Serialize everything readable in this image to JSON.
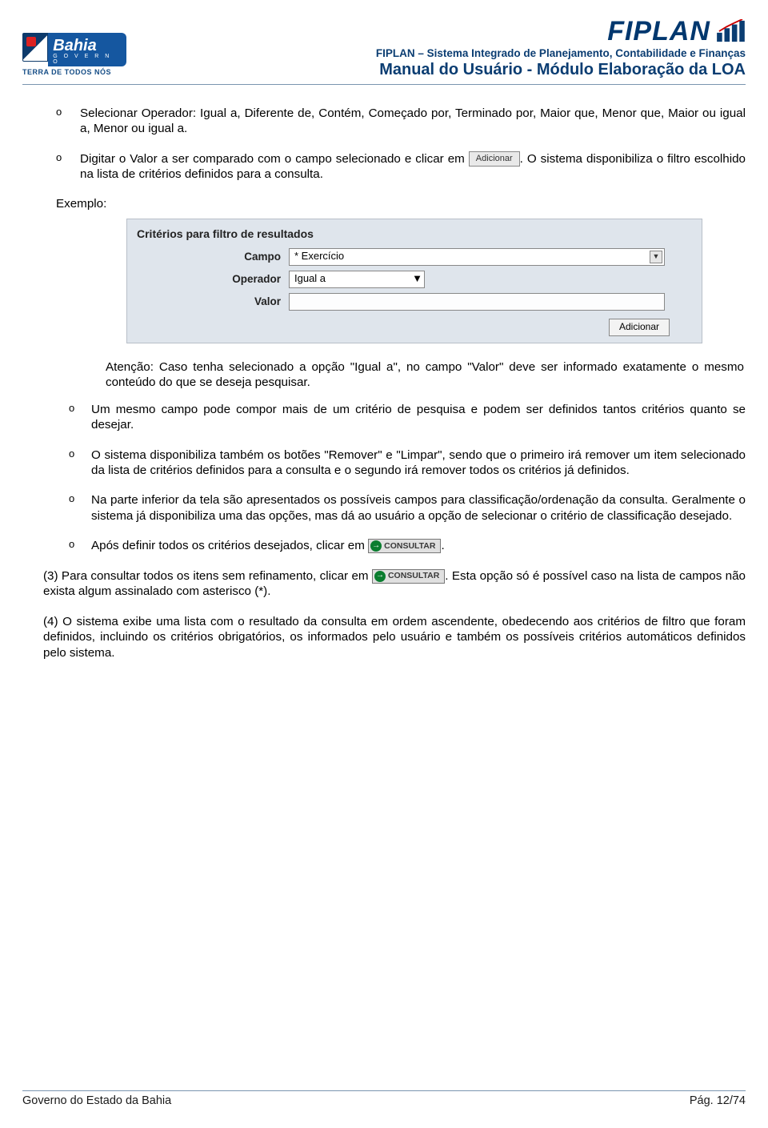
{
  "header": {
    "bahia_main": "Bahia",
    "bahia_sub": "G O V E R N O",
    "bahia_tag": "TERRA DE TODOS NÓS",
    "fiplan_brand": "FIPLAN",
    "subtitle": "FIPLAN – Sistema Integrado de Planejamento, Contabilidade e Finanças",
    "title": "Manual do Usuário - Módulo Elaboração da LOA"
  },
  "body": {
    "b1": "Selecionar Operador: Igual a, Diferente de, Contém, Começado por, Terminado por, Maior que, Menor que, Maior ou igual a, Menor ou igual a.",
    "b2a": "Digitar o Valor a ser comparado com o campo selecionado e clicar em ",
    "btn_adicionar_inline": "Adicionar",
    "b2b": ". O sistema disponibiliza o filtro escolhido na lista de critérios definidos para a consulta.",
    "exemplo_label": "Exemplo:",
    "filter": {
      "title": "Critérios para filtro de resultados",
      "campo_label": "Campo",
      "campo_value": "* Exercício",
      "operador_label": "Operador",
      "operador_value": "Igual a",
      "valor_label": "Valor",
      "valor_value": "",
      "add_btn": "Adicionar"
    },
    "atencao": "Atenção: Caso tenha selecionado a opção \"Igual a\", no campo \"Valor\" deve ser informado exatamente o mesmo conteúdo do que se deseja pesquisar.",
    "n1": "Um mesmo campo pode compor mais de um critério de pesquisa e podem ser definidos tantos critérios quanto se desejar.",
    "n2": "O sistema disponibiliza também os botões \"Remover\" e \"Limpar\", sendo que o primeiro irá remover um item selecionado da lista de critérios definidos para a consulta e o segundo irá remover todos os critérios já definidos.",
    "n3": "Na parte inferior da tela são apresentados os possíveis campos para classificação/ordenação da consulta. Geralmente o sistema já disponibiliza uma das opções, mas dá ao usuário a opção de selecionar o critério de classificação desejado.",
    "n4a": "Após definir todos os critérios desejados, clicar em ",
    "btn_consultar": "CONSULTAR",
    "n4b": ".",
    "p3a": "(3) Para consultar todos os itens sem refinamento, clicar em ",
    "p3b": ". Esta opção só é possível caso na lista de campos não exista algum assinalado com asterisco (*).",
    "p4": "(4) O sistema exibe uma lista com o resultado da consulta em ordem ascendente, obedecendo aos critérios de filtro que foram definidos, incluindo os critérios obrigatórios, os informados pelo usuário e também os possíveis critérios automáticos definidos pelo sistema."
  },
  "footer": {
    "left": "Governo do Estado da Bahia",
    "right": "Pág. 12/74"
  },
  "marker": "o"
}
